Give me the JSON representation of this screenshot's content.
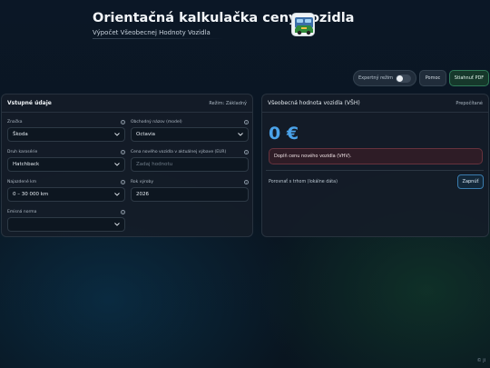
{
  "header": {
    "title": "Orientačná kalkulačka ceny vozidla",
    "subtitle": "Výpočet Všeobecnej Hodnoty Vozidla"
  },
  "toolbar": {
    "expert_mode_label": "Expertný režim",
    "expert_mode_on": false,
    "help_label": "Pomoc",
    "pdf_label": "Stiahnuť PDF"
  },
  "inputs_card": {
    "title": "Vstupné údaje",
    "mode": "Režim: Základný",
    "fields": {
      "brand": {
        "label": "Značka",
        "value": "Škoda"
      },
      "model": {
        "label": "Obchodný názov (model)",
        "value": "Octavia"
      },
      "body": {
        "label": "Druh karosérie",
        "value": "Hatchback"
      },
      "new_price": {
        "label": "Cena nového vozidla v aktuálnej výbave (EUR)",
        "placeholder": "Zadaj hodnotu"
      },
      "mileage": {
        "label": "Najazdené km",
        "value": "0 – 30 000 km"
      },
      "year": {
        "label": "Rok výroby",
        "value": "2026"
      },
      "emission": {
        "label": "Emisná norma",
        "value": ""
      }
    }
  },
  "result_card": {
    "title": "Všeobecná hodnota vozidla (VŠH)",
    "recalc_label": "Prepočítané",
    "price": "0 €",
    "alert": "Doplň cenu nového vozidla (VHV).",
    "compare_label": "Porovnať s trhom (lokálne dáta)",
    "compare_button": "Zapnúť"
  },
  "footer": {
    "copyright": "© ji"
  },
  "colors": {
    "accent": "#4ba3ea",
    "pdf_button": "#16382b",
    "alert_bg": "#461e26"
  }
}
